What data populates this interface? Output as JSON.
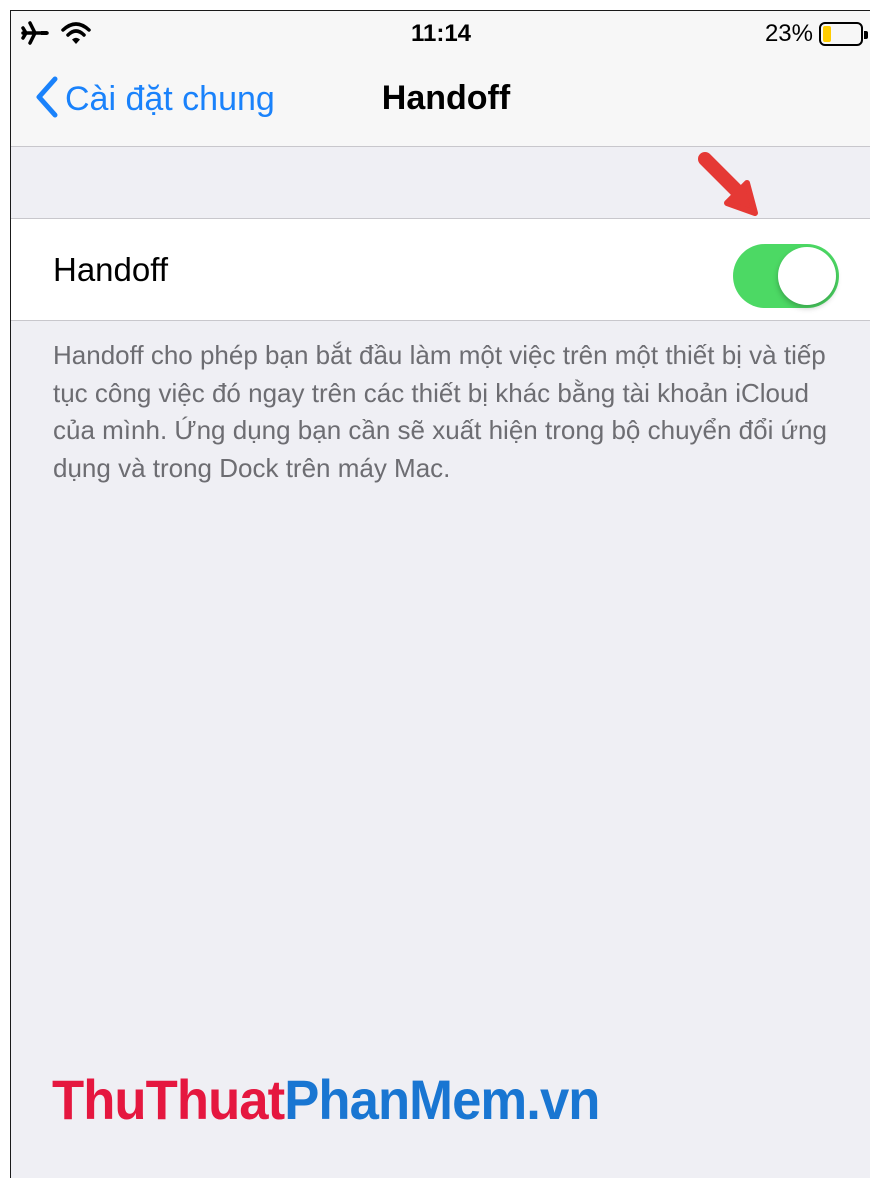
{
  "status": {
    "time": "11:14",
    "battery_percent": "23%",
    "battery_level": 0.23,
    "icons": [
      "airplane-icon",
      "wifi-icon",
      "battery-icon"
    ]
  },
  "nav": {
    "back_label": "Cài đặt chung",
    "title": "Handoff"
  },
  "setting": {
    "label": "Handoff",
    "enabled": true
  },
  "footnote": "Handoff cho phép bạn bắt đầu làm một việc trên một thiết bị và tiếp tục công việc đó ngay trên các thiết bị khác bằng tài khoản iCloud của mình. Ứng dụng bạn cần sẽ xuất hiện trong bộ chuyển đổi ứng dụng và trong Dock trên máy Mac.",
  "watermark": {
    "part1": "ThuThuat",
    "part2": "PhanMem",
    "part3": ".vn"
  },
  "colors": {
    "accent_blue": "#1a82fb",
    "toggle_on": "#4cd964",
    "battery_low": "#ffcc00",
    "arrow_red": "#e53935",
    "watermark_red": "#e5173f",
    "watermark_blue": "#1976d2"
  }
}
